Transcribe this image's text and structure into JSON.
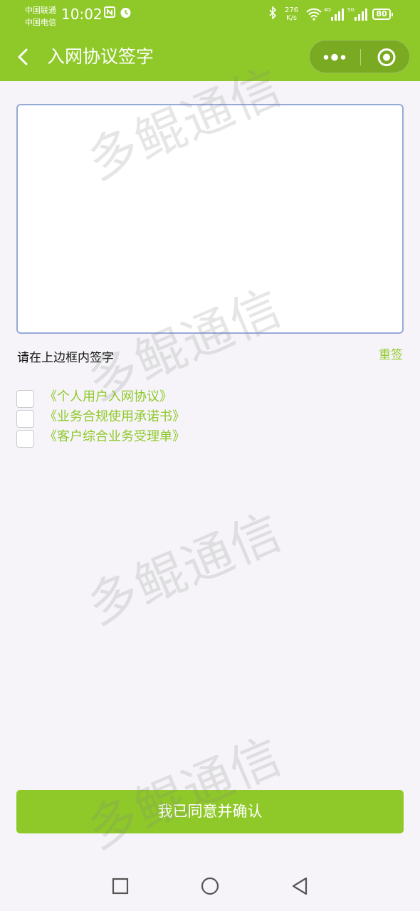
{
  "status_bar": {
    "carrier1": "中国联通",
    "carrier2": "中国电信",
    "time": "10:02",
    "net_speed_value": "276",
    "net_speed_unit": "K/s",
    "sig1_label": "4G",
    "sig2_label": "5G",
    "battery": "80",
    "nfc_icon": "nfc-icon",
    "alarm_icon": "alarm-icon",
    "bluetooth_icon": "bluetooth-icon",
    "wifi_icon": "wifi-icon"
  },
  "nav": {
    "title": "入网协议签字",
    "back_icon": "chevron-left-icon",
    "more_icon": "more-dots-icon",
    "close_icon": "target-close-icon"
  },
  "signature": {
    "hint": "请在上边框内签字",
    "reset": "重签"
  },
  "agreements": [
    {
      "label": "《个人用户入网协议》",
      "checked": false
    },
    {
      "label": "《业务合规使用承诺书》",
      "checked": false
    },
    {
      "label": "《客户综合业务受理单》",
      "checked": false
    }
  ],
  "confirm_button": "我已同意并确认",
  "watermark": "多鲲通信",
  "colors": {
    "brand": "#8fc929",
    "background": "#f6f4f8",
    "pad_border": "#97a9d9"
  },
  "system_nav": [
    "square-icon",
    "circle-icon",
    "triangle-back-icon"
  ]
}
